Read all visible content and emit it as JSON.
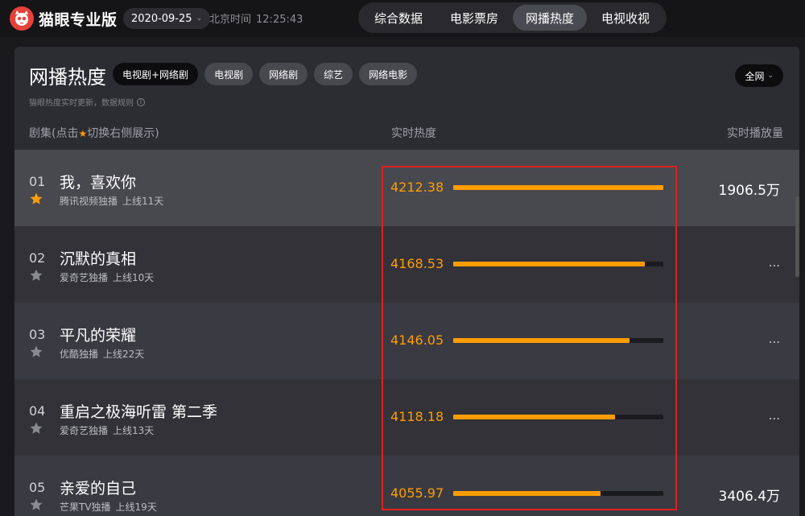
{
  "app": {
    "logo_text": "猫眼专业版",
    "date": "2020-09-25",
    "clock_label": "北京时间",
    "clock_time": "12:25:43"
  },
  "nav": {
    "tabs": [
      {
        "label": "综合数据",
        "active": false
      },
      {
        "label": "电影票房",
        "active": false
      },
      {
        "label": "网播热度",
        "active": true
      },
      {
        "label": "电视收视",
        "active": false
      }
    ]
  },
  "panel": {
    "title": "网播热度",
    "filters": [
      {
        "label": "电视剧+网络剧",
        "active": true
      },
      {
        "label": "电视剧",
        "active": false
      },
      {
        "label": "网络剧",
        "active": false
      },
      {
        "label": "综艺",
        "active": false
      },
      {
        "label": "网络电影",
        "active": false
      }
    ],
    "scope_label": "全网",
    "subnote": "猫眼热度实时更新，数据规则",
    "columns": {
      "title_prefix": "剧集(点击",
      "title_suffix": "切换右侧展示)",
      "heat": "实时热度",
      "play": "实时播放量"
    },
    "rows": [
      {
        "rank": "01",
        "name": "我，喜欢你",
        "platform": "腾讯视频独播",
        "days": "上线11天",
        "heat": "4212.38",
        "heat_ratio": 1.0,
        "play": "1906.5万",
        "starred": true
      },
      {
        "rank": "02",
        "name": "沉默的真相",
        "platform": "爱奇艺独播",
        "days": "上线10天",
        "heat": "4168.53",
        "heat_ratio": 0.91,
        "play": "...",
        "starred": false
      },
      {
        "rank": "03",
        "name": "平凡的荣耀",
        "platform": "优酷独播",
        "days": "上线22天",
        "heat": "4146.05",
        "heat_ratio": 0.84,
        "play": "...",
        "starred": false
      },
      {
        "rank": "04",
        "name": "重启之极海听雷 第二季",
        "platform": "爱奇艺独播",
        "days": "上线13天",
        "heat": "4118.18",
        "heat_ratio": 0.77,
        "play": "...",
        "starred": false
      },
      {
        "rank": "05",
        "name": "亲爱的自己",
        "platform": "芒果TV独播",
        "days": "上线19天",
        "heat": "4055.97",
        "heat_ratio": 0.7,
        "play": "3406.4万",
        "starred": false
      }
    ]
  },
  "colors": {
    "accent": "#ff9d00",
    "star_inactive": "#8a8a92",
    "highlight": "#e02020"
  }
}
